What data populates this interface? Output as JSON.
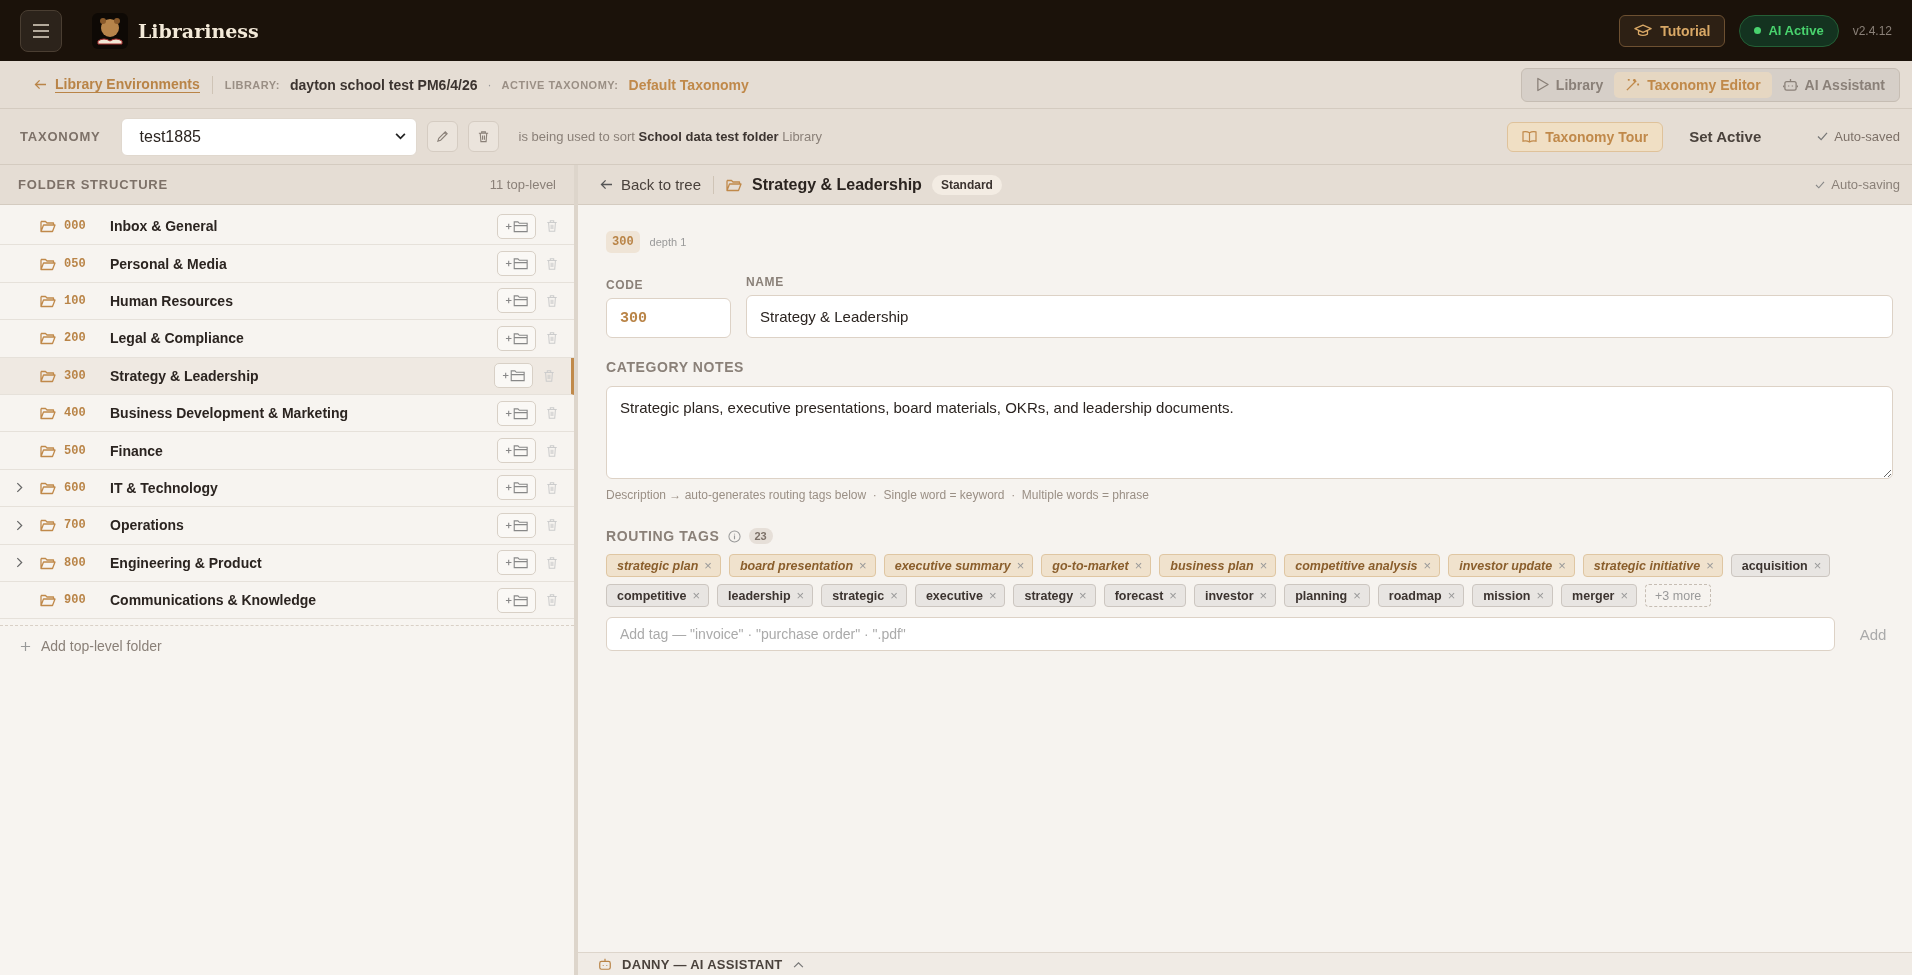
{
  "app": {
    "name": "Librariness",
    "tutorial": "Tutorial",
    "ai_status": {
      "label": "AI Active",
      "on": true
    },
    "version": "v2.4.12"
  },
  "breadcrumb": {
    "back": "Library Environments",
    "library_label": "LIBRARY:",
    "library": "dayton school test PM6/4/26",
    "separator": "·",
    "taxonomy_label": "ACTIVE TAXONOMY:",
    "taxonomy": "Default Taxonomy"
  },
  "modes": [
    {
      "label": "Library",
      "selected": false
    },
    {
      "label": "Taxonomy Editor",
      "selected": true
    },
    {
      "label": "AI Assistant",
      "selected": false
    }
  ],
  "taxonomy_bar": {
    "label": "TAXONOMY",
    "value": "test1885",
    "usage": "is being used to sort **School data test folder** Library",
    "tour": "Taxonomy Tour",
    "set_active": "Set Active",
    "saved": "Auto-saved"
  },
  "folder_structure": {
    "title": "FOLDER STRUCTURE",
    "count": "11 top-level",
    "add": "Add top-level folder",
    "folders": [
      {
        "code": "000",
        "name": "Inbox & General",
        "expandable": false,
        "selected": false
      },
      {
        "code": "050",
        "name": "Personal & Media",
        "expandable": false,
        "selected": false
      },
      {
        "code": "100",
        "name": "Human Resources",
        "expandable": false,
        "selected": false
      },
      {
        "code": "200",
        "name": "Legal & Compliance",
        "expandable": false,
        "selected": false
      },
      {
        "code": "300",
        "name": "Strategy & Leadership",
        "expandable": false,
        "selected": true
      },
      {
        "code": "400",
        "name": "Business Development & Marketing",
        "expandable": false,
        "selected": false
      },
      {
        "code": "500",
        "name": "Finance",
        "expandable": false,
        "selected": false
      },
      {
        "code": "600",
        "name": "IT & Technology",
        "expandable": true,
        "selected": false
      },
      {
        "code": "700",
        "name": "Operations",
        "expandable": true,
        "selected": false
      },
      {
        "code": "800",
        "name": "Engineering & Product",
        "expandable": true,
        "selected": false
      },
      {
        "code": "900",
        "name": "Communications & Knowledge",
        "expandable": false,
        "selected": false
      }
    ]
  },
  "editor": {
    "back": "Back to tree",
    "title": "Strategy & Leadership",
    "badge": "Standard",
    "saving": "Auto-saving",
    "code_chip": "300",
    "depth": "depth 1",
    "code_label": "CODE",
    "code": "300",
    "name_label": "NAME",
    "name": "Strategy & Leadership",
    "notes_label": "CATEGORY NOTES",
    "notes": "Strategic plans, executive presentations, board materials, OKRs, and leadership documents.",
    "hint": "Description → auto-generates routing tags below  ·  Single word = keyword  ·  Multiple words = phrase",
    "tags_label": "ROUTING TAGS",
    "tags_count": "23",
    "tags": [
      {
        "text": "strategic plan",
        "kind": "phrase"
      },
      {
        "text": "board presentation",
        "kind": "phrase"
      },
      {
        "text": "executive summary",
        "kind": "phrase"
      },
      {
        "text": "go-to-market",
        "kind": "phrase"
      },
      {
        "text": "business plan",
        "kind": "phrase"
      },
      {
        "text": "competitive analysis",
        "kind": "phrase"
      },
      {
        "text": "investor update",
        "kind": "phrase"
      },
      {
        "text": "strategic initiative",
        "kind": "phrase"
      },
      {
        "text": "acquisition",
        "kind": "keyword"
      },
      {
        "text": "competitive",
        "kind": "keyword"
      },
      {
        "text": "leadership",
        "kind": "keyword"
      },
      {
        "text": "strategic",
        "kind": "keyword"
      },
      {
        "text": "executive",
        "kind": "keyword"
      },
      {
        "text": "strategy",
        "kind": "keyword"
      },
      {
        "text": "forecast",
        "kind": "keyword"
      },
      {
        "text": "investor",
        "kind": "keyword"
      },
      {
        "text": "planning",
        "kind": "keyword"
      },
      {
        "text": "roadmap",
        "kind": "keyword"
      },
      {
        "text": "mission",
        "kind": "keyword"
      },
      {
        "text": "merger",
        "kind": "keyword"
      }
    ],
    "remove_glyph": "×",
    "more": "+3 more",
    "add_placeholder": "Add tag — \"invoice\" · \"purchase order\" · \".pdf\"",
    "add": "Add"
  },
  "assistant": {
    "title": "DANNY — AI ASSISTANT"
  }
}
